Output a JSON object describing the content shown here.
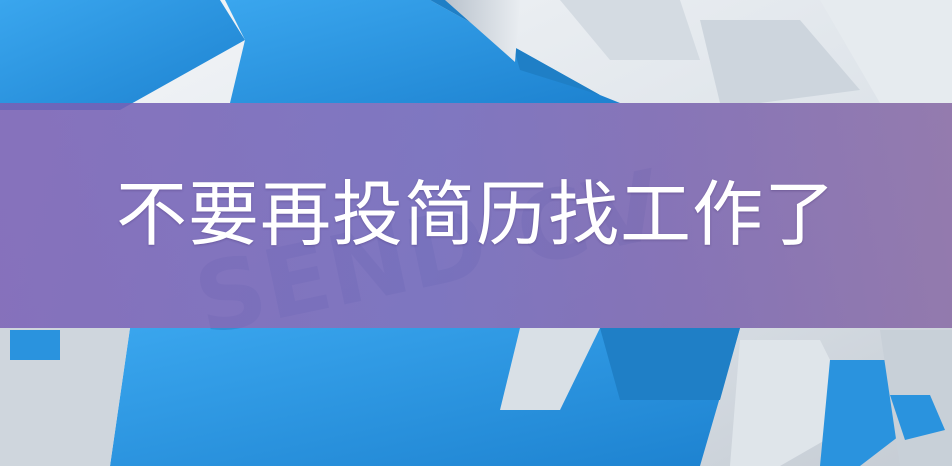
{
  "banner": {
    "title": "不要再投简历找工作了"
  },
  "photo": {
    "caption_text": "SEND CV",
    "colors": {
      "arrow_blue": "#2e9be6",
      "arrow_blue_dark": "#1f7fc6",
      "background": "#e3e8ee",
      "overlay": "#7a63b4"
    }
  }
}
